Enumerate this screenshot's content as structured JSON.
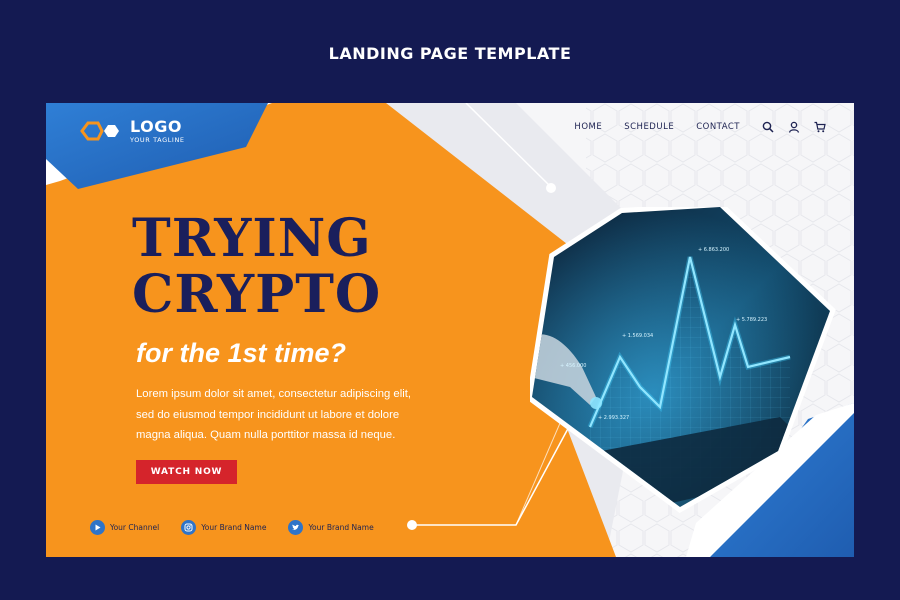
{
  "page": {
    "title": "LANDING PAGE TEMPLATE"
  },
  "logo": {
    "name": "LOGO",
    "tagline": "YOUR TAGLINE"
  },
  "nav": {
    "links": [
      {
        "label": "HOME"
      },
      {
        "label": "SCHEDULE"
      },
      {
        "label": "CONTACT"
      }
    ],
    "icons": [
      "search-icon",
      "user-icon",
      "cart-icon"
    ]
  },
  "hero": {
    "headline_line1": "TRYING",
    "headline_line2": "CRYPTO",
    "subheadline": "for the 1st time?",
    "body_line1": "Lorem ipsum dolor sit amet, consectetur adipiscing elit,",
    "body_line2": "sed do eiusmod tempor incididunt ut labore et dolore",
    "body_line3": "magna aliqua. Quam nulla porttitor massa id neque.",
    "cta_label": "WATCH NOW"
  },
  "socials": [
    {
      "icon": "play-icon",
      "label": "Your Channel"
    },
    {
      "icon": "instagram-icon",
      "label": "Your Brand Name"
    },
    {
      "icon": "twitter-icon",
      "label": "Your Brand Name"
    }
  ],
  "photo": {
    "labels": [
      "+ 6.863.200",
      "+ 5.789.223",
      "+ 1.569.034",
      "+ 456.000",
      "+ 2.993.327"
    ]
  },
  "colors": {
    "background": "#141a52",
    "orange": "#f7941d",
    "blue": "#2f74c8",
    "navy": "#1a1f5c",
    "cta_red": "#d5242b"
  }
}
